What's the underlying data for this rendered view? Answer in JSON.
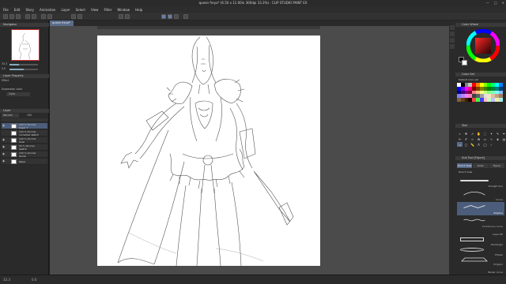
{
  "window": {
    "title": "queen freya* (6.50 x 11.00in 300dpi 33.3%) - CLIP STUDIO PAINT EX",
    "minimize": "—",
    "maximize": "□",
    "close": "✕"
  },
  "menu": [
    "File",
    "Edit",
    "Story",
    "Animation",
    "Layer",
    "Select",
    "View",
    "Filter",
    "Window",
    "Help"
  ],
  "canvas_tab": "queen freya*",
  "left": {
    "navigator_title": "Navigator",
    "zoom_value": "33.3",
    "angle_value": "0.0",
    "layer_property_title": "Layer Property",
    "effect_label": "Effect",
    "expression_label": "Expression color",
    "expression_value": "Color",
    "layer_title": "Layer",
    "blend_mode": "Normal",
    "opacity": "100",
    "layers": [
      {
        "pct": "100 % Normal",
        "name": "Layer 7",
        "selected": true
      },
      {
        "pct": "100 % Normal",
        "name": "corrected sketch",
        "selected": false
      },
      {
        "pct": "100 % Normal",
        "name": "lines",
        "selected": false
      },
      {
        "pct": "50 % Normal",
        "name": "sketch",
        "selected": false
      },
      {
        "pct": "100 % Normal",
        "name": "Guide",
        "selected": false
      },
      {
        "pct": "",
        "name": "Paper",
        "selected": false
      }
    ]
  },
  "right": {
    "color_wheel_title": "Color Wheel",
    "color_set_title": "Color Set",
    "color_set_name": "Default color set",
    "tool_title": "Tool",
    "subtool_title": "Sub Tool [Figure]",
    "subtool_tabs": [
      "Direct draw",
      "Ruler",
      "Figure"
    ],
    "stroke_label": "Direct draw",
    "brushes": [
      {
        "name": "Straight line",
        "selected": false
      },
      {
        "name": "Curve",
        "selected": false
      },
      {
        "name": "Polyline",
        "selected": true
      },
      {
        "name": "Continuous curve",
        "selected": false
      },
      {
        "name": "Lasso fill",
        "selected": false
      },
      {
        "name": "Rectangle",
        "selected": false
      },
      {
        "name": "Ellipse",
        "selected": false
      },
      {
        "name": "Polygon",
        "selected": false
      },
      {
        "name": "Bezier curve",
        "selected": false
      }
    ],
    "accent_color": "#4b5d7a",
    "swatches": [
      "#ffffff",
      "#000000",
      "#808080",
      "#c0c0c0",
      "#ff0000",
      "#ff8000",
      "#ffff00",
      "#80ff00",
      "#00ff00",
      "#00ff80",
      "#00ffff",
      "#0080ff",
      "#0000ff",
      "#8000ff",
      "#ff00ff",
      "#ff0080",
      "#800000",
      "#804000",
      "#808000",
      "#408000",
      "#008000",
      "#008040",
      "#008080",
      "#004080",
      "#000080",
      "#400080",
      "#800080",
      "#800040",
      "#ff8080",
      "#ffc080",
      "#ffff80",
      "#c0ff80",
      "#80ff80",
      "#80ffc0",
      "#80ffff",
      "#80c0ff",
      "#8080ff",
      "#c080ff",
      "#ff80ff",
      "#ff80c0",
      "#404040",
      "#606060",
      "#a0a0a0",
      "#e0e0e0",
      "#ffe0c0",
      "#e0c0a0",
      "#c0a080",
      "#a08060",
      "#806040",
      "#604020",
      "#402000",
      "#200000",
      "#ff4040",
      "#40ff40",
      "#4040ff",
      "#ffc0c0",
      "#c0ffc0",
      "#c0c0ff",
      "#f0f0a0",
      "#a0f0f0"
    ]
  },
  "status": {
    "zoom": "33.3",
    "angle": "0.0"
  }
}
